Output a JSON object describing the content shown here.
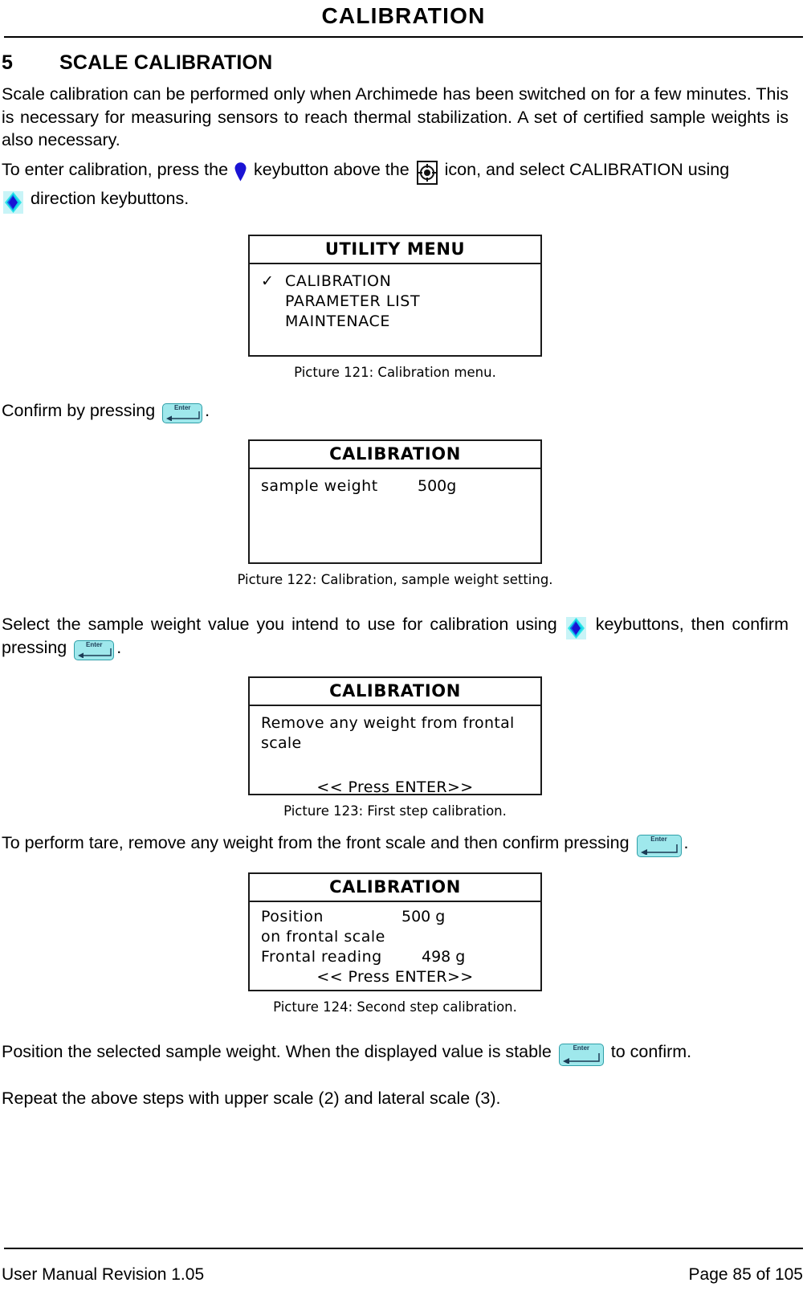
{
  "header": {
    "title": "CALIBRATION"
  },
  "section": {
    "number": "5",
    "title": "SCALE CALIBRATION"
  },
  "paragraphs": {
    "intro": "Scale calibration can be performed only when Archimede has been switched on for a few minutes. This is necessary for measuring sensors to reach thermal stabilization. A set of certified sample weights is also necessary.",
    "enter_calibration_a": "To enter calibration, press the",
    "enter_calibration_b": "keybutton above the",
    "enter_calibration_c": "icon, and select CALIBRATION using",
    "enter_calibration_d": "direction keybuttons.",
    "confirm_pressing_a": "Confirm by pressing",
    "confirm_pressing_b": ".",
    "select_weight_a": "Select the sample weight value you intend to use for calibration using",
    "select_weight_b": "keybuttons, then confirm pressing",
    "select_weight_c": ".",
    "tare_a": "To perform tare, remove any weight from the front scale and then confirm pressing",
    "tare_b": ".",
    "position_a": "Position the selected sample weight. When the displayed value is stable",
    "position_b": "to confirm.",
    "repeat": "Repeat the above steps with upper scale (2) and lateral scale (3)."
  },
  "figures": [
    {
      "id": "utility-menu",
      "screen_title": "UTILITY MENU",
      "items": [
        {
          "check": "✓",
          "label": "CALIBRATION"
        },
        {
          "check": "",
          "label": "PARAMETER LIST"
        },
        {
          "check": "",
          "label": "MAINTENACE"
        }
      ],
      "caption": "Picture 121: Calibration menu."
    },
    {
      "id": "calibration-sample-weight",
      "screen_title": "CALIBRATION",
      "label": "sample weight",
      "value": "500g",
      "caption": "Picture 122: Calibration, sample weight setting."
    },
    {
      "id": "calibration-first-step",
      "screen_title": "CALIBRATION",
      "message": "Remove any weight from frontal scale",
      "prompt": "<< Press ENTER>>",
      "caption": "Picture 123: First step calibration."
    },
    {
      "id": "calibration-second-step",
      "screen_title": "CALIBRATION",
      "position_label": "Position",
      "position_value": "500 g",
      "position_line2": "on frontal scale",
      "reading_label": "Frontal reading",
      "reading_value": "498 g",
      "prompt": "<< Press ENTER>>",
      "caption": "Picture 124: Second step calibration."
    }
  ],
  "icons": {
    "enter_label": "Enter"
  },
  "footer": {
    "left": "User Manual Revision 1.05",
    "right": "Page 85 of 105"
  },
  "colors": {
    "enter_key_fill": "#9fe8ec",
    "enter_key_border": "#2f9fa8",
    "keybutton_blue": "#1a13d4",
    "keybutton_cyan": "#2ee5e8"
  }
}
